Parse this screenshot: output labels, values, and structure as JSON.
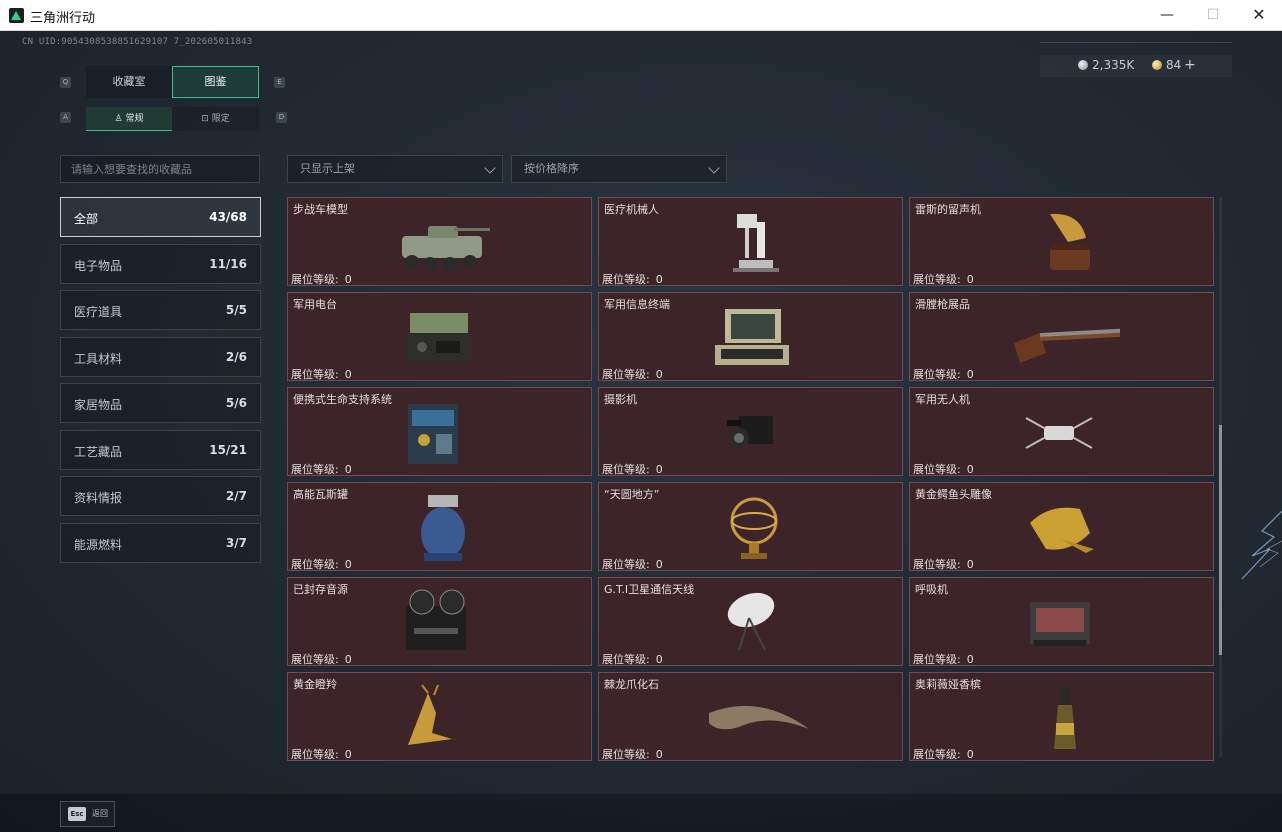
{
  "window": {
    "title": "三角洲行动",
    "min_icon": "minimize-icon",
    "max_icon": "maximize-icon",
    "close_icon": "close-icon"
  },
  "uid": "CN UID:9054308538851629107 7_202605011843",
  "currency": {
    "silver": "2,335K",
    "gold": "84",
    "plus": "+"
  },
  "tabs": {
    "left_key": "Q",
    "right_key": "E",
    "items": [
      {
        "label": "收藏室"
      },
      {
        "label": "图鉴"
      }
    ],
    "active": "图鉴"
  },
  "subtabs": {
    "left_key": "A",
    "right_key": "D",
    "items": [
      {
        "label": "常规",
        "icon": "trophy-icon"
      },
      {
        "label": "限定",
        "icon": "gift-icon"
      }
    ],
    "active": "常规"
  },
  "search": {
    "placeholder": "请输入想要查找的收藏品"
  },
  "filters": {
    "shelf": "只显示上架",
    "sort": "按价格降序"
  },
  "categories": [
    {
      "name": "全部",
      "count": "43/68"
    },
    {
      "name": "电子物品",
      "count": "11/16"
    },
    {
      "name": "医疗道具",
      "count": "5/5"
    },
    {
      "name": "工具材料",
      "count": "2/6"
    },
    {
      "name": "家居物品",
      "count": "5/6"
    },
    {
      "name": "工艺藏品",
      "count": "15/21"
    },
    {
      "name": "资料情报",
      "count": "2/7"
    },
    {
      "name": "能源燃料",
      "count": "3/7"
    }
  ],
  "level_label": "展位等级:",
  "items": [
    {
      "name": "步战车模型",
      "level": "0",
      "icon": "armored-vehicle-icon"
    },
    {
      "name": "医疗机械人",
      "level": "0",
      "icon": "medical-robot-icon"
    },
    {
      "name": "雷斯的留声机",
      "level": "0",
      "icon": "gramophone-icon"
    },
    {
      "name": "军用电台",
      "level": "0",
      "icon": "military-radio-icon"
    },
    {
      "name": "军用信息终端",
      "level": "0",
      "icon": "rugged-laptop-icon"
    },
    {
      "name": "滑膛枪展品",
      "level": "0",
      "icon": "musket-icon"
    },
    {
      "name": "便携式生命支持系统",
      "level": "0",
      "icon": "life-support-icon"
    },
    {
      "name": "摄影机",
      "level": "0",
      "icon": "camera-icon"
    },
    {
      "name": "军用无人机",
      "level": "0",
      "icon": "drone-icon"
    },
    {
      "name": "高能瓦斯罐",
      "level": "0",
      "icon": "gas-tank-icon"
    },
    {
      "name": "“天圆地方”",
      "level": "0",
      "icon": "armillary-sphere-icon"
    },
    {
      "name": "黄金鳄鱼头雕像",
      "level": "0",
      "icon": "gold-crocodile-icon"
    },
    {
      "name": "已封存音源",
      "level": "0",
      "icon": "reel-recorder-icon"
    },
    {
      "name": "G.T.I卫星通信天线",
      "level": "0",
      "icon": "satellite-dish-icon"
    },
    {
      "name": "呼吸机",
      "level": "0",
      "icon": "ventilator-icon"
    },
    {
      "name": "黄金瞪羚",
      "level": "0",
      "icon": "gold-gazelle-icon"
    },
    {
      "name": "棘龙爪化石",
      "level": "0",
      "icon": "claw-fossil-icon"
    },
    {
      "name": "奥莉薇娅香槟",
      "level": "0",
      "icon": "champagne-icon"
    }
  ],
  "footer": {
    "esc_key": "Esc",
    "back_label": "返回"
  }
}
